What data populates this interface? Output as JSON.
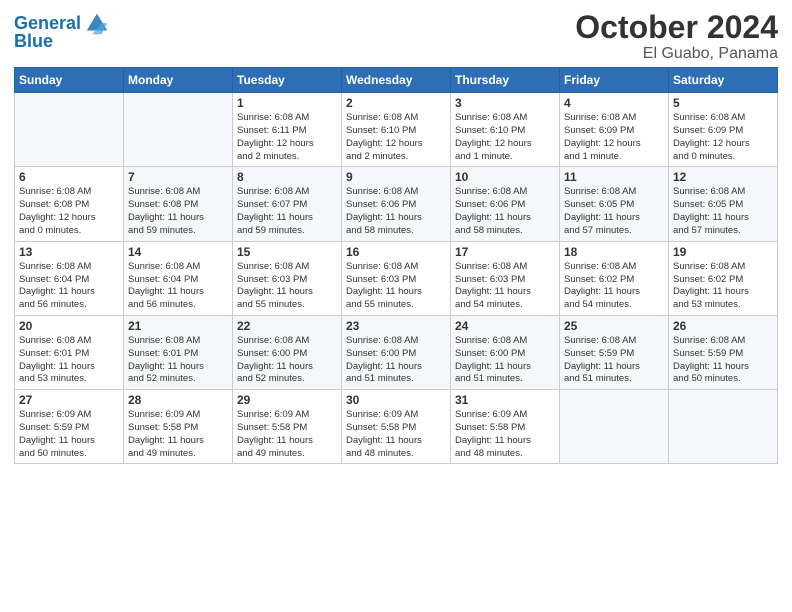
{
  "logo": {
    "line1": "General",
    "line2": "Blue"
  },
  "month": "October 2024",
  "location": "El Guabo, Panama",
  "weekdays": [
    "Sunday",
    "Monday",
    "Tuesday",
    "Wednesday",
    "Thursday",
    "Friday",
    "Saturday"
  ],
  "weeks": [
    [
      {
        "day": "",
        "detail": ""
      },
      {
        "day": "",
        "detail": ""
      },
      {
        "day": "1",
        "detail": "Sunrise: 6:08 AM\nSunset: 6:11 PM\nDaylight: 12 hours\nand 2 minutes."
      },
      {
        "day": "2",
        "detail": "Sunrise: 6:08 AM\nSunset: 6:10 PM\nDaylight: 12 hours\nand 2 minutes."
      },
      {
        "day": "3",
        "detail": "Sunrise: 6:08 AM\nSunset: 6:10 PM\nDaylight: 12 hours\nand 1 minute."
      },
      {
        "day": "4",
        "detail": "Sunrise: 6:08 AM\nSunset: 6:09 PM\nDaylight: 12 hours\nand 1 minute."
      },
      {
        "day": "5",
        "detail": "Sunrise: 6:08 AM\nSunset: 6:09 PM\nDaylight: 12 hours\nand 0 minutes."
      }
    ],
    [
      {
        "day": "6",
        "detail": "Sunrise: 6:08 AM\nSunset: 6:08 PM\nDaylight: 12 hours\nand 0 minutes."
      },
      {
        "day": "7",
        "detail": "Sunrise: 6:08 AM\nSunset: 6:08 PM\nDaylight: 11 hours\nand 59 minutes."
      },
      {
        "day": "8",
        "detail": "Sunrise: 6:08 AM\nSunset: 6:07 PM\nDaylight: 11 hours\nand 59 minutes."
      },
      {
        "day": "9",
        "detail": "Sunrise: 6:08 AM\nSunset: 6:06 PM\nDaylight: 11 hours\nand 58 minutes."
      },
      {
        "day": "10",
        "detail": "Sunrise: 6:08 AM\nSunset: 6:06 PM\nDaylight: 11 hours\nand 58 minutes."
      },
      {
        "day": "11",
        "detail": "Sunrise: 6:08 AM\nSunset: 6:05 PM\nDaylight: 11 hours\nand 57 minutes."
      },
      {
        "day": "12",
        "detail": "Sunrise: 6:08 AM\nSunset: 6:05 PM\nDaylight: 11 hours\nand 57 minutes."
      }
    ],
    [
      {
        "day": "13",
        "detail": "Sunrise: 6:08 AM\nSunset: 6:04 PM\nDaylight: 11 hours\nand 56 minutes."
      },
      {
        "day": "14",
        "detail": "Sunrise: 6:08 AM\nSunset: 6:04 PM\nDaylight: 11 hours\nand 56 minutes."
      },
      {
        "day": "15",
        "detail": "Sunrise: 6:08 AM\nSunset: 6:03 PM\nDaylight: 11 hours\nand 55 minutes."
      },
      {
        "day": "16",
        "detail": "Sunrise: 6:08 AM\nSunset: 6:03 PM\nDaylight: 11 hours\nand 55 minutes."
      },
      {
        "day": "17",
        "detail": "Sunrise: 6:08 AM\nSunset: 6:03 PM\nDaylight: 11 hours\nand 54 minutes."
      },
      {
        "day": "18",
        "detail": "Sunrise: 6:08 AM\nSunset: 6:02 PM\nDaylight: 11 hours\nand 54 minutes."
      },
      {
        "day": "19",
        "detail": "Sunrise: 6:08 AM\nSunset: 6:02 PM\nDaylight: 11 hours\nand 53 minutes."
      }
    ],
    [
      {
        "day": "20",
        "detail": "Sunrise: 6:08 AM\nSunset: 6:01 PM\nDaylight: 11 hours\nand 53 minutes."
      },
      {
        "day": "21",
        "detail": "Sunrise: 6:08 AM\nSunset: 6:01 PM\nDaylight: 11 hours\nand 52 minutes."
      },
      {
        "day": "22",
        "detail": "Sunrise: 6:08 AM\nSunset: 6:00 PM\nDaylight: 11 hours\nand 52 minutes."
      },
      {
        "day": "23",
        "detail": "Sunrise: 6:08 AM\nSunset: 6:00 PM\nDaylight: 11 hours\nand 51 minutes."
      },
      {
        "day": "24",
        "detail": "Sunrise: 6:08 AM\nSunset: 6:00 PM\nDaylight: 11 hours\nand 51 minutes."
      },
      {
        "day": "25",
        "detail": "Sunrise: 6:08 AM\nSunset: 5:59 PM\nDaylight: 11 hours\nand 51 minutes."
      },
      {
        "day": "26",
        "detail": "Sunrise: 6:08 AM\nSunset: 5:59 PM\nDaylight: 11 hours\nand 50 minutes."
      }
    ],
    [
      {
        "day": "27",
        "detail": "Sunrise: 6:09 AM\nSunset: 5:59 PM\nDaylight: 11 hours\nand 50 minutes."
      },
      {
        "day": "28",
        "detail": "Sunrise: 6:09 AM\nSunset: 5:58 PM\nDaylight: 11 hours\nand 49 minutes."
      },
      {
        "day": "29",
        "detail": "Sunrise: 6:09 AM\nSunset: 5:58 PM\nDaylight: 11 hours\nand 49 minutes."
      },
      {
        "day": "30",
        "detail": "Sunrise: 6:09 AM\nSunset: 5:58 PM\nDaylight: 11 hours\nand 48 minutes."
      },
      {
        "day": "31",
        "detail": "Sunrise: 6:09 AM\nSunset: 5:58 PM\nDaylight: 11 hours\nand 48 minutes."
      },
      {
        "day": "",
        "detail": ""
      },
      {
        "day": "",
        "detail": ""
      }
    ]
  ]
}
